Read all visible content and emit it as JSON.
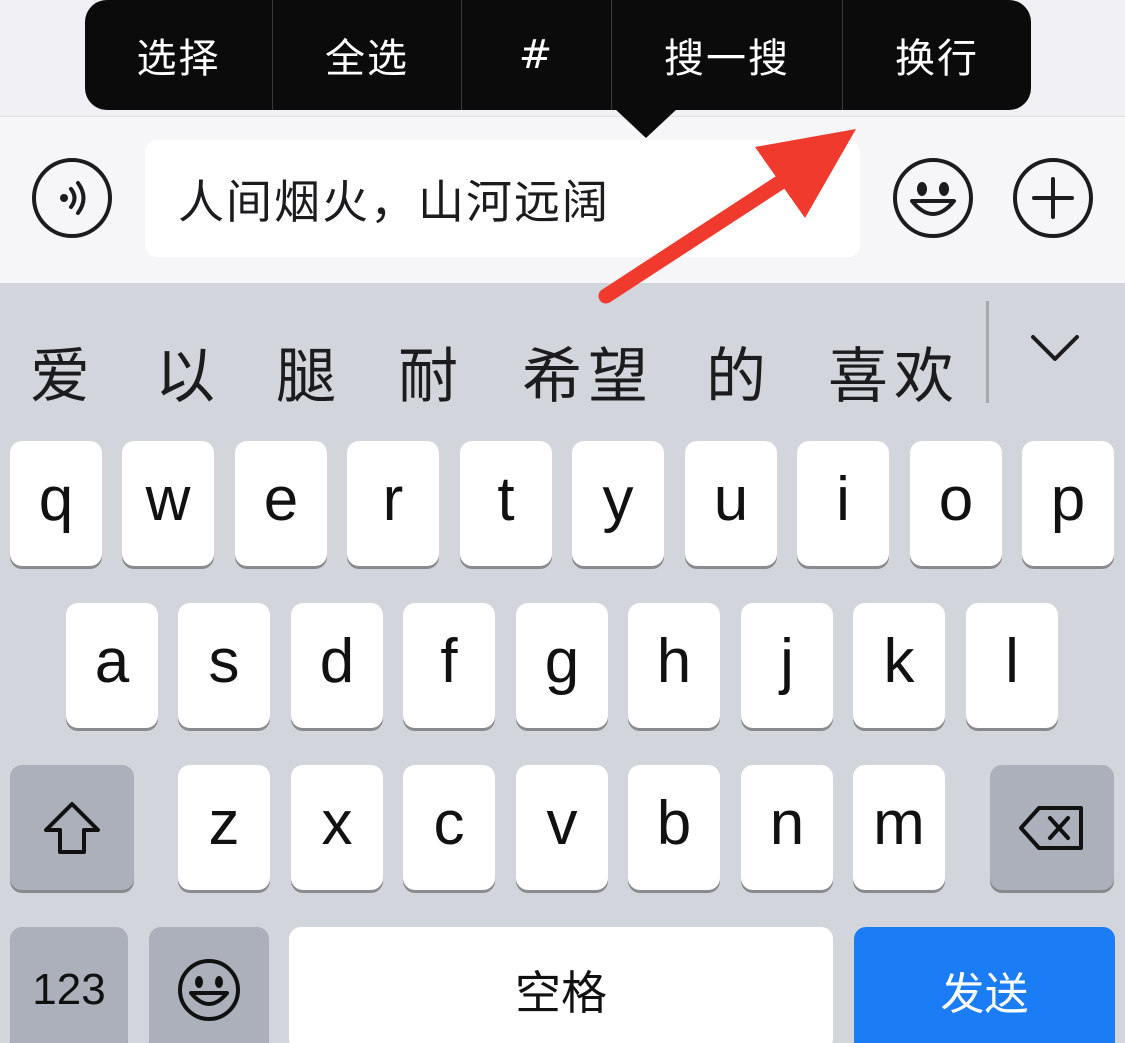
{
  "context_menu": {
    "items": [
      "选择",
      "全选",
      "#",
      "搜一搜",
      "换行"
    ]
  },
  "input_bar": {
    "text": "人间烟火，山河远阔",
    "voice_icon": "voice-icon",
    "emoji_icon": "emoji-icon",
    "add_icon": "plus-icon"
  },
  "candidates": {
    "items": [
      "爱",
      "以",
      "腿",
      "耐",
      "希望",
      "的",
      "喜欢"
    ],
    "expand_icon": "chevron-down-icon"
  },
  "keyboard": {
    "row1": [
      "q",
      "w",
      "e",
      "r",
      "t",
      "y",
      "u",
      "i",
      "o",
      "p"
    ],
    "row2": [
      "a",
      "s",
      "d",
      "f",
      "g",
      "h",
      "j",
      "k",
      "l"
    ],
    "row3": [
      "z",
      "x",
      "c",
      "v",
      "b",
      "n",
      "m"
    ],
    "shift_icon": "shift-icon",
    "delete_icon": "backspace-icon",
    "numbers_label": "123",
    "emoji_key_icon": "emoji-icon",
    "space_label": "空格",
    "send_label": "发送"
  },
  "colors": {
    "send_accent": "#1a7df5",
    "annotation_arrow": "#f03a2e"
  }
}
